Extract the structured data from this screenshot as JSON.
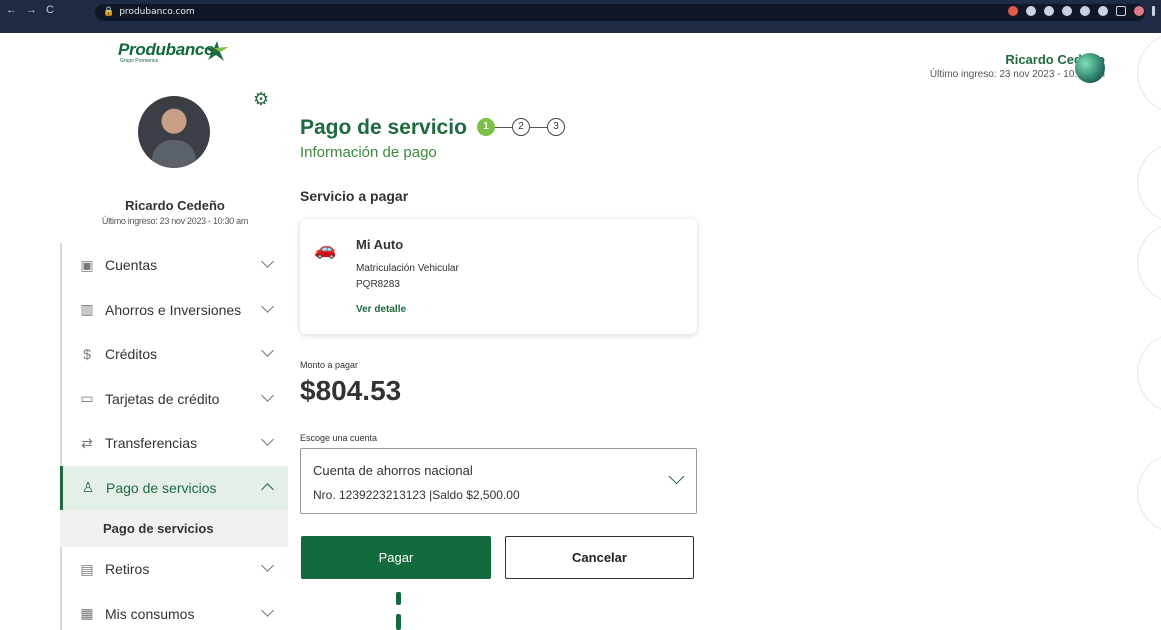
{
  "browser": {
    "url": "produbanco.com",
    "nav_icons": [
      "back-icon",
      "forward-icon",
      "reload-icon"
    ]
  },
  "brand": {
    "name": "Produbanco",
    "tagline": "Grupo Promerica",
    "color": "#1d6b3f"
  },
  "header": {
    "user_name": "Ricardo Cedeño",
    "last_login": "Último ingreso: 23 nov 2023 - 10:30 am"
  },
  "sidebar": {
    "user_name": "Ricardo Cedeño",
    "last_login": "Último ingreso: 23 nov 2023 - 10:30 am",
    "items": [
      {
        "label": "Cuentas",
        "icon": "wallet-icon"
      },
      {
        "label": "Ahorros e Inversiones",
        "icon": "chart-icon"
      },
      {
        "label": "Créditos",
        "icon": "hand-coin-icon"
      },
      {
        "label": "Tarjetas de crédito",
        "icon": "card-icon"
      },
      {
        "label": "Transferencias",
        "icon": "transfer-icon"
      },
      {
        "label": "Pago de servicios",
        "icon": "user-service-icon",
        "active": true
      },
      {
        "label": "Retiros",
        "icon": "atm-icon"
      },
      {
        "label": "Mis consumos",
        "icon": "consumption-icon"
      }
    ],
    "sub_item": "Pago de servicios"
  },
  "main": {
    "title": "Pago de servicio",
    "steps": [
      "1",
      "2",
      "3"
    ],
    "current_step": 1,
    "subtitle": "Información de pago",
    "section_label": "Servicio a pagar",
    "service": {
      "name": "Mi Auto",
      "description": "Matriculación Vehicular",
      "plate": "PQR8283",
      "link": "Ver detalle"
    },
    "amount_label": "Monto a pagar",
    "amount": "$804.53",
    "account_label": "Escoge una cuenta",
    "account": {
      "name": "Cuenta de ahorros nacional",
      "detail": "Nro. 1239223213123 |Saldo $2,500.00"
    },
    "pay_button": "Pagar",
    "cancel_button": "Cancelar"
  }
}
